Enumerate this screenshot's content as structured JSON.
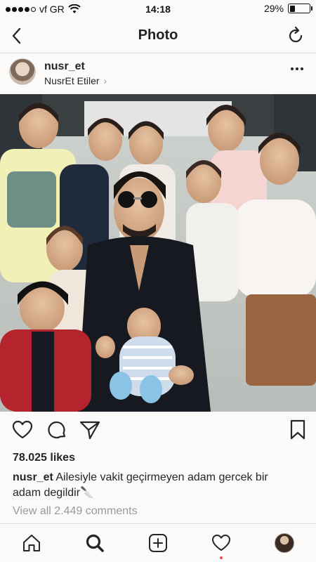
{
  "status_bar": {
    "carrier": "vf GR",
    "time": "14:18",
    "battery_percent": "29%",
    "battery_level": 0.29,
    "signal_bars": 5,
    "signal_filled": 4
  },
  "nav": {
    "title": "Photo",
    "back_icon": "chevron-left-icon",
    "refresh_icon": "refresh-icon"
  },
  "post": {
    "username": "nusr_et",
    "location": "NusrEt Etiler",
    "location_chevron": "›",
    "likes": "78.025 likes",
    "caption_user": "nusr_et",
    "caption_text": "Ailesiyle vakit geçirmeyen adam gercek bir adam degildir🔪",
    "comments_link": "View all 2.449 comments"
  },
  "actions": {
    "icons": [
      "heart-icon",
      "comment-icon",
      "share-icon",
      "bookmark-icon"
    ]
  },
  "tab_bar": {
    "icons": [
      "home-icon",
      "search-icon",
      "add-post-icon",
      "activity-heart-icon",
      "profile-avatar"
    ],
    "active": "search-icon"
  },
  "colors": {
    "text": "#262626",
    "muted": "#9a9a9a",
    "divider": "#dcdcdc",
    "notification": "#ed4956"
  }
}
